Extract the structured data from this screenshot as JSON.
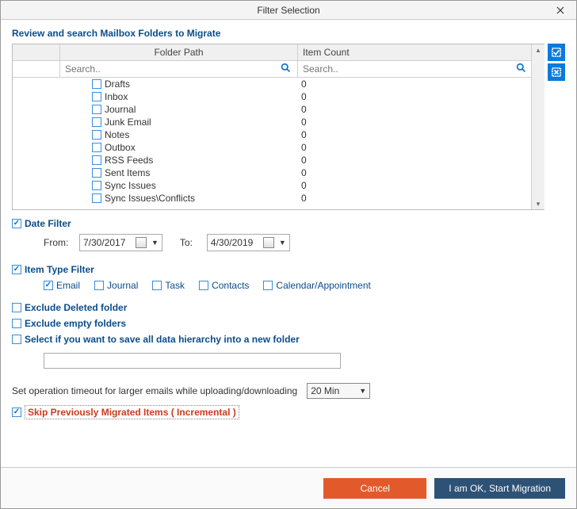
{
  "window": {
    "title": "Filter Selection"
  },
  "header": {
    "title": "Review and search Mailbox Folders to Migrate"
  },
  "grid": {
    "col_path": "Folder Path",
    "col_count": "Item Count",
    "search_path_placeholder": "Search..",
    "search_count_placeholder": "Search..",
    "rows": [
      {
        "name": "Drafts",
        "count": "0"
      },
      {
        "name": "Inbox",
        "count": "0"
      },
      {
        "name": "Journal",
        "count": "0"
      },
      {
        "name": "Junk Email",
        "count": "0"
      },
      {
        "name": "Notes",
        "count": "0"
      },
      {
        "name": "Outbox",
        "count": "0"
      },
      {
        "name": "RSS Feeds",
        "count": "0"
      },
      {
        "name": "Sent Items",
        "count": "0"
      },
      {
        "name": "Sync Issues",
        "count": "0"
      },
      {
        "name": "Sync Issues\\Conflicts",
        "count": "0"
      }
    ]
  },
  "date_filter": {
    "label": "Date Filter",
    "from_label": "From:",
    "from_value": "7/30/2017",
    "to_label": "To:",
    "to_value": "4/30/2019"
  },
  "item_type_filter": {
    "label": "Item Type Filter",
    "email": "Email",
    "journal": "Journal",
    "task": "Task",
    "contacts": "Contacts",
    "calendar": "Calendar/Appointment"
  },
  "exclude": {
    "deleted": "Exclude Deleted folder",
    "empty": "Exclude empty folders",
    "hierarchy": "Select if you want to save all data hierarchy into a new folder"
  },
  "timeout": {
    "label": "Set operation timeout for larger emails while uploading/downloading",
    "value": "20 Min"
  },
  "skip": {
    "label": "Skip Previously Migrated Items ( Incremental )"
  },
  "footer": {
    "cancel": "Cancel",
    "start": "I am OK, Start Migration"
  }
}
